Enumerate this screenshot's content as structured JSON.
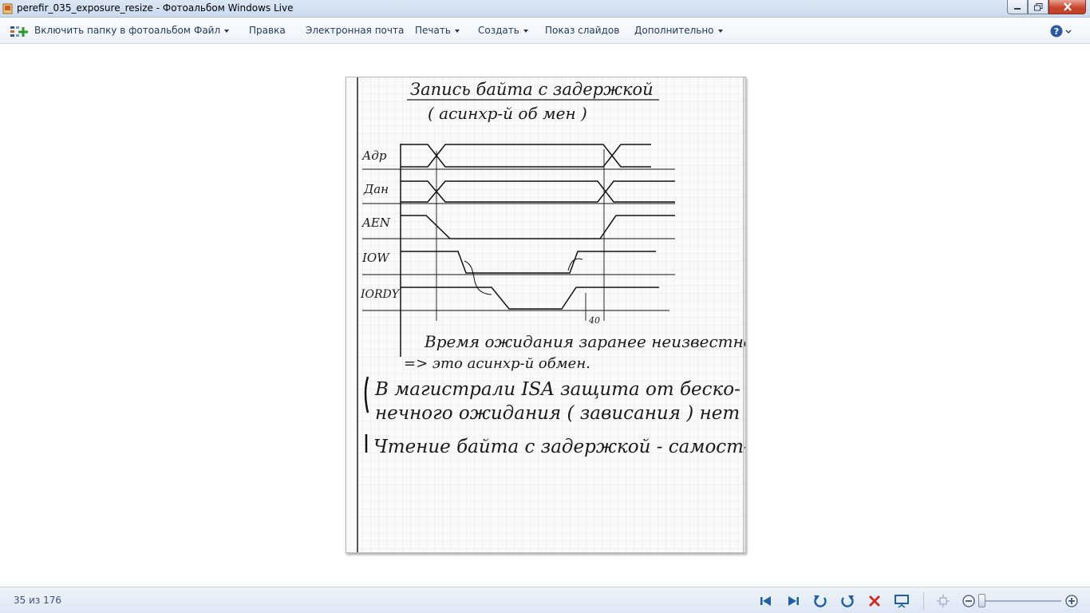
{
  "window": {
    "title": "perefir_035_exposure_resize - Фотоальбом Windows Live"
  },
  "menu": {
    "include_folder": "Включить папку в фотоальбом",
    "file": "Файл",
    "edit": "Правка",
    "email": "Электронная почта",
    "print": "Печать",
    "create": "Создать",
    "slideshow": "Показ слайдов",
    "more": "Дополнительно"
  },
  "photo": {
    "title_line1": "Запись байта с задержкой",
    "title_line2": "( асинхр-й об мен )",
    "signals": [
      "Адр",
      "Дан",
      "AEN",
      "IOW",
      "IORDY"
    ],
    "tick_label": "40",
    "note_line1": "Время ожидания заранее неизвестно.",
    "note_line2": "=> это асинхр-й обмен.",
    "remark_line1": "В магистрали ISA защита от беско-",
    "remark_line2": "нечного ожидания ( зависания ) нет",
    "remark_line3": "Чтение байта с задержкой - самост-о."
  },
  "status": {
    "counter": "35 из 176"
  },
  "zoom": {
    "level": 0.0
  },
  "colors": {
    "menu_text": "#1e395b",
    "nav_blue": "#1f5fa8",
    "delete_red": "#d22a1e"
  }
}
